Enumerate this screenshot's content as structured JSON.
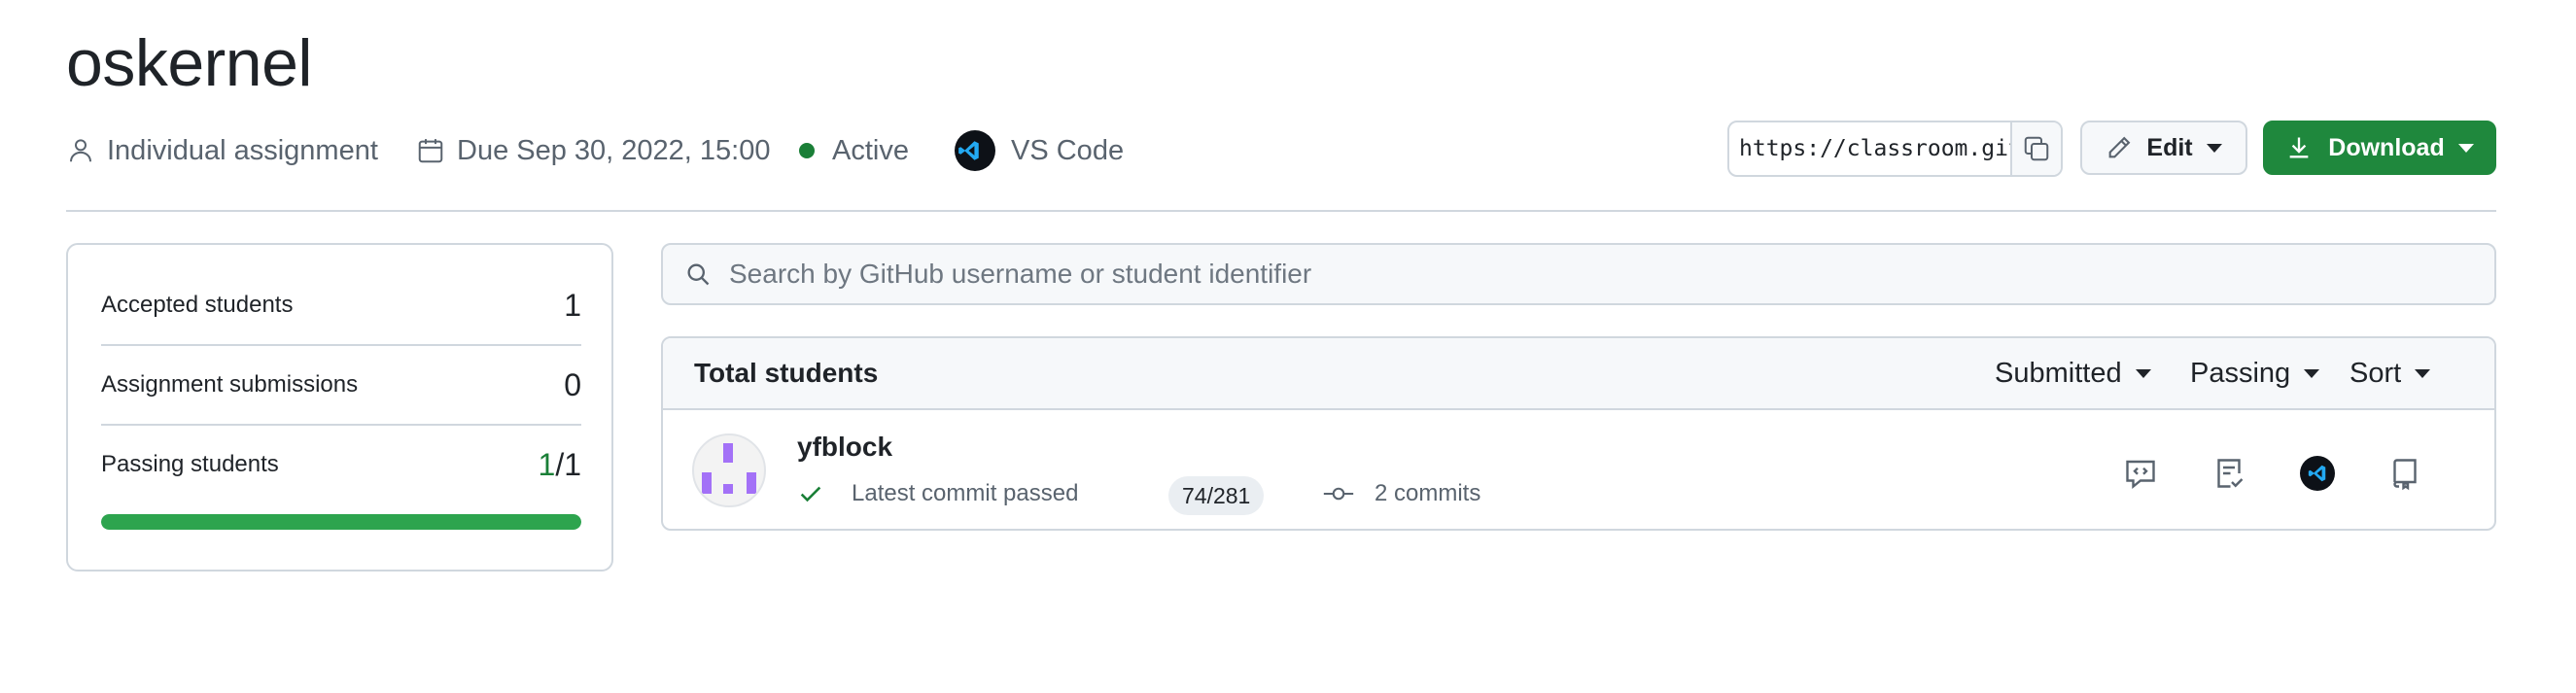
{
  "assignment": {
    "title": "oskernel",
    "type": "Individual assignment",
    "due": "Due Sep 30, 2022, 15:00",
    "status": "Active",
    "editor": "VS Code"
  },
  "toolbar": {
    "url": "https://classroom.github.com/a/",
    "edit_label": "Edit",
    "download_label": "Download"
  },
  "stats": {
    "accepted_label": "Accepted students",
    "accepted_value": "1",
    "submissions_label": "Assignment submissions",
    "submissions_value": "0",
    "passing_label": "Passing students",
    "passing_value_num": "1",
    "passing_value_den": "/1",
    "passing_fraction": 1.0
  },
  "search": {
    "placeholder": "Search by GitHub username or student identifier"
  },
  "table": {
    "header": "Total students",
    "filters": [
      "Submitted",
      "Passing",
      "Sort"
    ],
    "rows": [
      {
        "username": "yfblock",
        "status": "Latest commit passed",
        "score": "74/281",
        "commits": "2 commits"
      }
    ]
  },
  "colors": {
    "primary_button": "#1f883d",
    "progress": "#2da44e",
    "active_dot": "#1a7f37",
    "avatar": "#a371f7"
  }
}
